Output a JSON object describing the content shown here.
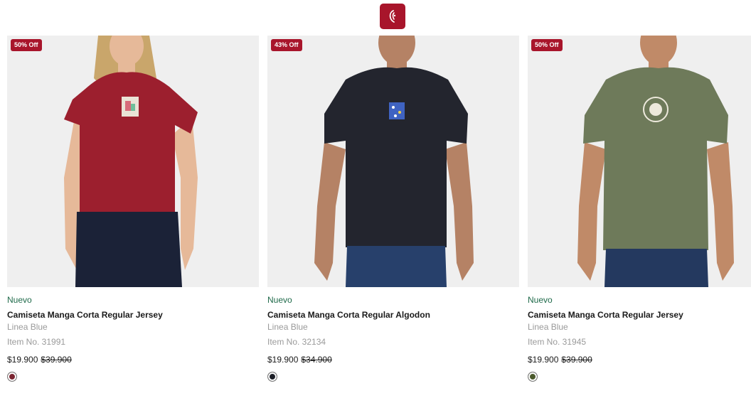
{
  "header": {
    "logo_icon": "brand-logo-icon",
    "accent": "#a8152b"
  },
  "products": [
    {
      "badge": "50% Off",
      "tag": "Nuevo",
      "title": "Camiseta Manga Corta Regular Jersey",
      "brand": "Linea Blue",
      "item_no": "Item No. 31991",
      "price": "$19.900",
      "old_price": "$39.900",
      "swatch_color": "#7b2431",
      "shirt_color": "#9c1f2e"
    },
    {
      "badge": "43% Off",
      "tag": "Nuevo",
      "title": "Camiseta Manga Corta Regular Algodon",
      "brand": "Linea Blue",
      "item_no": "Item No. 32134",
      "price": "$19.900",
      "old_price": "$34.900",
      "swatch_color": "#1c1f27",
      "shirt_color": "#23252e"
    },
    {
      "badge": "50% Off",
      "tag": "Nuevo",
      "title": "Camiseta Manga Corta Regular Jersey",
      "brand": "Linea Blue",
      "item_no": "Item No. 31945",
      "price": "$19.900",
      "old_price": "$39.900",
      "swatch_color": "#4b5a2c",
      "shirt_color": "#6e7a5a"
    }
  ]
}
